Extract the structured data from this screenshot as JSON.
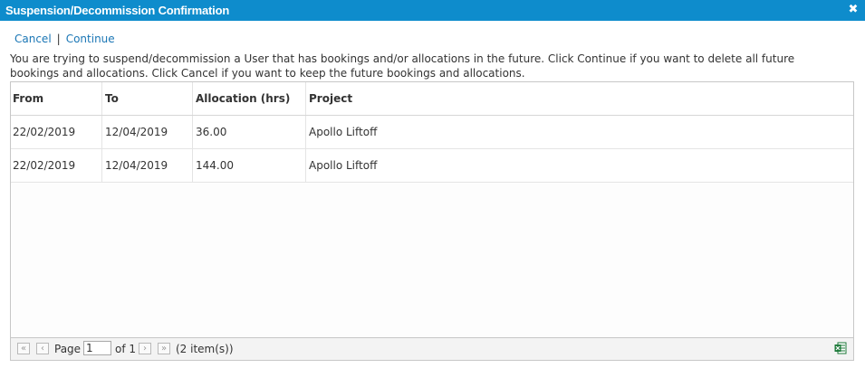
{
  "dialog": {
    "title": "Suspension/Decommission Confirmation",
    "close_glyph": "✖"
  },
  "actions": {
    "cancel_label": "Cancel",
    "separator": "|",
    "continue_label": "Continue"
  },
  "message": "You are trying to suspend/decommission a User that has bookings and/or allocations in the future. Click Continue if you want to delete all future bookings and allocations. Click Cancel if you want to keep the future bookings and allocations.",
  "table": {
    "columns": [
      "From",
      "To",
      "Allocation (hrs)",
      "Project"
    ],
    "rows": [
      [
        "22/02/2019",
        "12/04/2019",
        "36.00",
        "Apollo Liftoff"
      ],
      [
        "22/02/2019",
        "12/04/2019",
        "144.00",
        "Apollo Liftoff"
      ]
    ]
  },
  "pager": {
    "first_icon": "double-chevron-left-icon",
    "prev_icon": "chevron-left-icon",
    "page_label": "Page",
    "page_value": "1",
    "of_label": "of 1",
    "next_icon": "chevron-right-icon",
    "last_icon": "double-chevron-right-icon",
    "count_text": "(2 item(s))",
    "export_icon": "excel-export-icon"
  },
  "colors": {
    "titlebar": "#0e8ccc",
    "link": "#1a76b5",
    "excel": "#1d7a3a"
  }
}
